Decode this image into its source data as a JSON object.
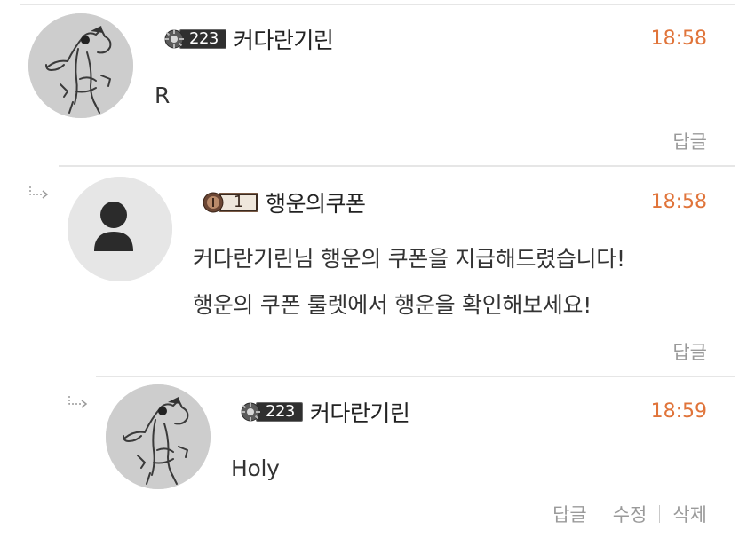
{
  "comments": [
    {
      "nickname": "커다란기린",
      "level": "223",
      "level_badge_icon": "gear-icon",
      "avatar_icon": "giraffe-sketch-avatar",
      "time": "18:58",
      "text": "R",
      "actions": [
        "답글"
      ]
    },
    {
      "nickname": "행운의쿠폰",
      "level": "1",
      "level_badge_icon": "bronze-rank-icon",
      "avatar_icon": "default-user-icon",
      "time": "18:58",
      "text_lines": [
        "커다란기린님 행운의 쿠폰을 지급해드렸습니다!",
        "행운의 쿠폰 룰렛에서 행운을 확인해보세요!"
      ],
      "actions": [
        "답글"
      ]
    },
    {
      "nickname": "커다란기린",
      "level": "223",
      "level_badge_icon": "gear-icon",
      "avatar_icon": "giraffe-sketch-avatar",
      "time": "18:59",
      "text": "Holy",
      "actions": [
        "답글",
        "수정",
        "삭제"
      ]
    }
  ],
  "colors": {
    "time": "#e0743a",
    "divider": "#e6e6e6",
    "action_text": "#9a9a9a"
  }
}
